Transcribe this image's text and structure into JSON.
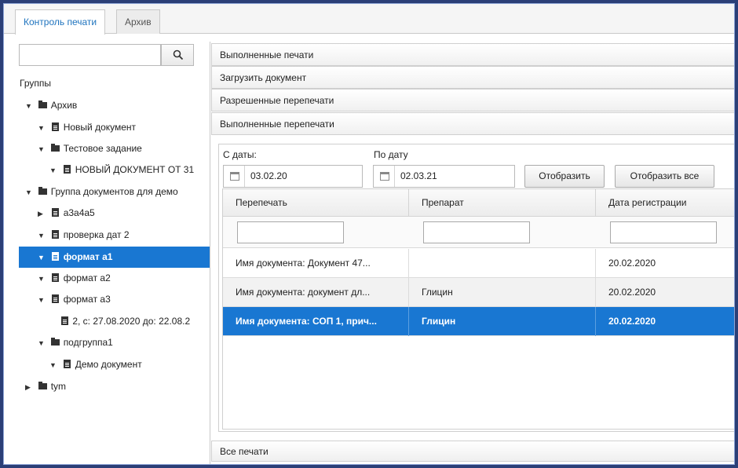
{
  "tabs": [
    {
      "label": "Контроль печати",
      "active": true
    },
    {
      "label": "Архив",
      "active": false
    }
  ],
  "search": {
    "value": "",
    "button_icon": "search-icon"
  },
  "groups_label": "Группы",
  "tree": [
    {
      "label": "Архив",
      "level": 0,
      "type": "folder",
      "expanded": true
    },
    {
      "label": "Новый документ",
      "level": 1,
      "type": "doc",
      "expanded": true
    },
    {
      "label": "Тестовое задание",
      "level": 1,
      "type": "folder",
      "expanded": true
    },
    {
      "label": "НОВЫЙ ДОКУМЕНТ ОТ 31",
      "level": 2,
      "type": "doc",
      "expanded": true
    },
    {
      "label": "Группа документов для демо",
      "level": 0,
      "type": "folder",
      "expanded": true
    },
    {
      "label": "а3а4а5",
      "level": 1,
      "type": "doc",
      "expanded": false
    },
    {
      "label": "проверка дат 2",
      "level": 1,
      "type": "doc",
      "expanded": true
    },
    {
      "label": "формат а1",
      "level": 1,
      "type": "doc",
      "expanded": true,
      "selected": true
    },
    {
      "label": "формат а2",
      "level": 1,
      "type": "doc",
      "expanded": true
    },
    {
      "label": "формат а3",
      "level": 1,
      "type": "doc",
      "expanded": true
    },
    {
      "label": "2, с: 27.08.2020 до: 22.08.2",
      "level": 2,
      "type": "doc",
      "leaf": true
    },
    {
      "label": "подгруппа1",
      "level": 1,
      "type": "folder",
      "expanded": true
    },
    {
      "label": "Демо документ",
      "level": 2,
      "type": "doc",
      "expanded": true
    },
    {
      "label": "tym",
      "level": 0,
      "type": "folder",
      "expanded": false
    }
  ],
  "accordion": [
    "Выполненные печати",
    "Загрузить документ",
    "Разрешенные перепечати",
    "Выполненные перепечати"
  ],
  "filters": {
    "from_label": "С даты:",
    "from_value": "03.02.20",
    "to_label": "По дату",
    "to_value": "02.03.21",
    "show_button": "Отобразить",
    "show_all_button": "Отобразить все"
  },
  "table": {
    "columns": [
      "Перепечать",
      "Препарат",
      "Дата регистрации"
    ],
    "rows": [
      {
        "cells": [
          "Имя документа: Документ 47...",
          "",
          "20.02.2020"
        ]
      },
      {
        "cells": [
          "Имя документа: документ дл...",
          "Глицин",
          "20.02.2020"
        ]
      },
      {
        "cells": [
          "Имя документа: СОП 1, прич...",
          "Глицин",
          "20.02.2020"
        ],
        "selected": true
      }
    ]
  },
  "footer": "Все печати",
  "colors": {
    "accent": "#1977d2",
    "tab_active_text": "#1e73be",
    "frame_bg": "#2b3f77"
  }
}
